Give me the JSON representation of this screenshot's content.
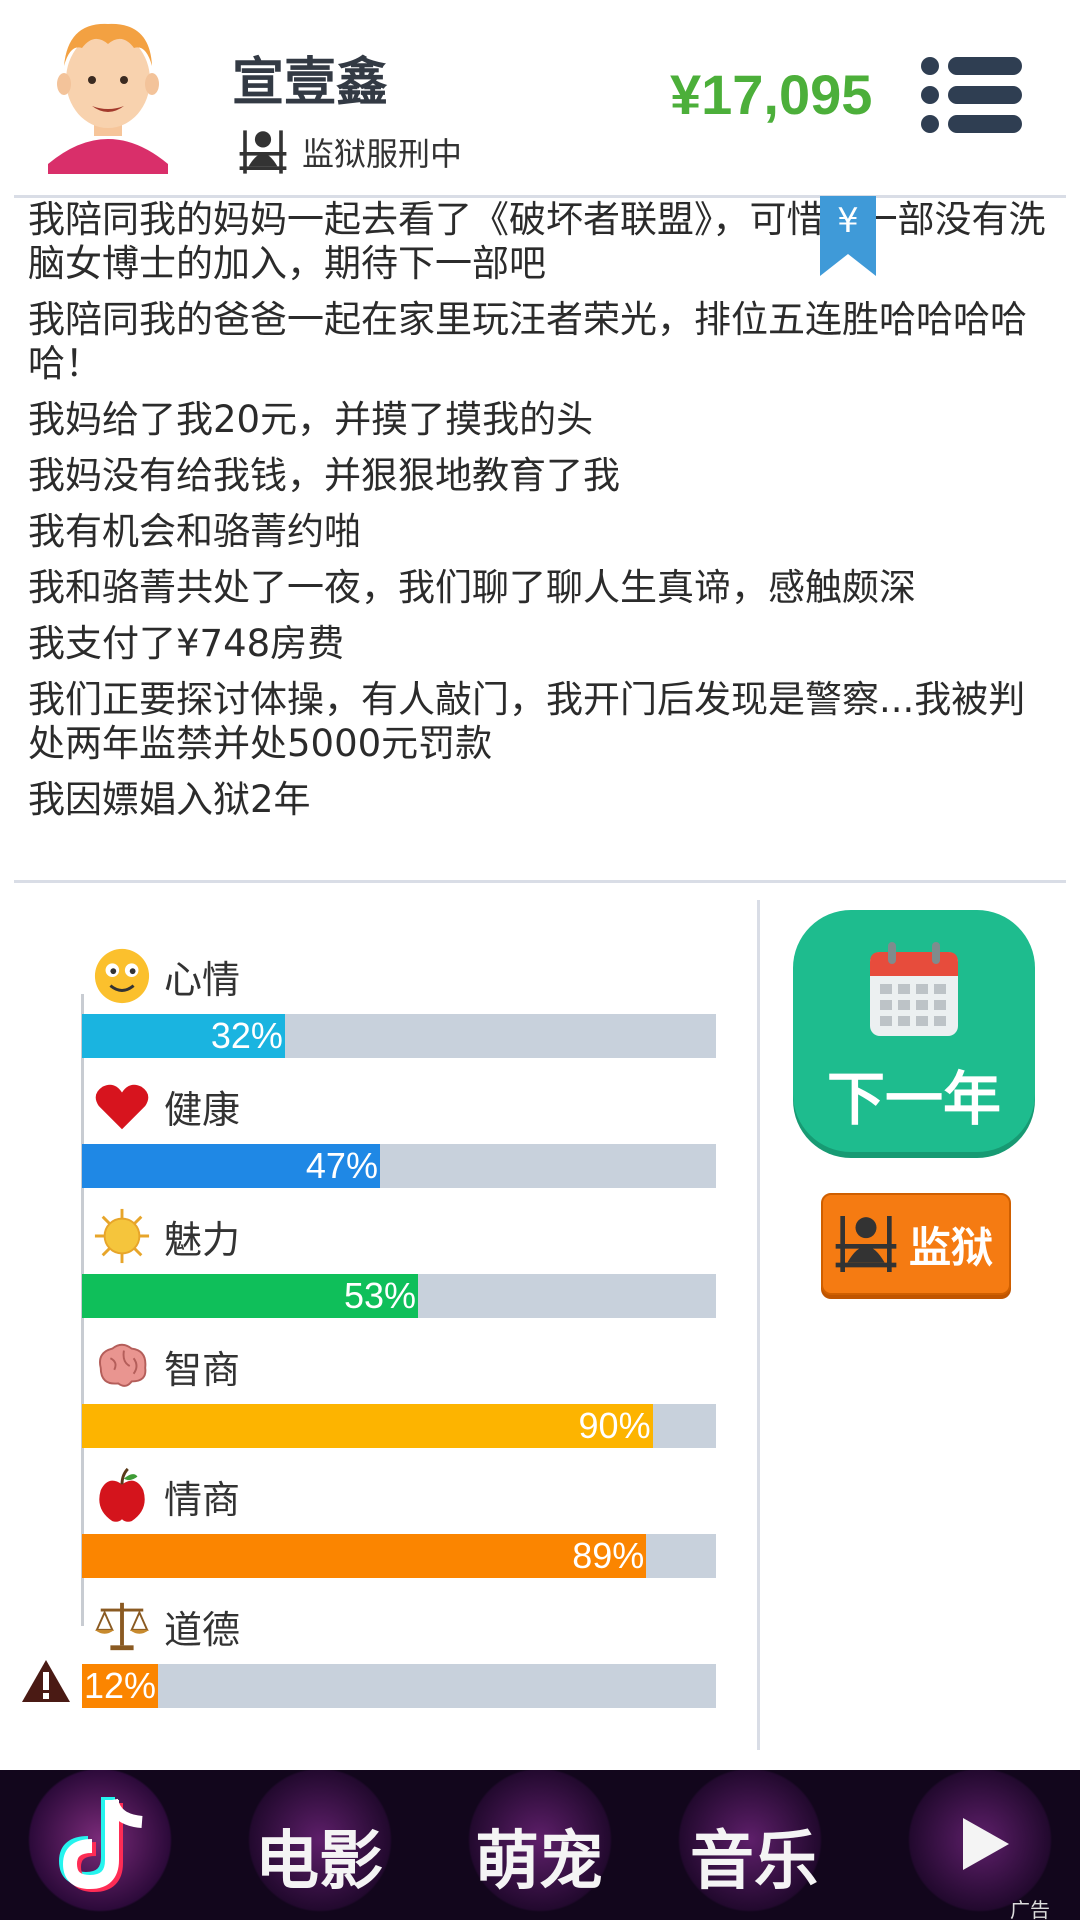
{
  "header": {
    "name": "宣壹鑫",
    "status": "监狱服刑中",
    "money": "¥17,095"
  },
  "log": [
    "我陪同我的妈妈一起去看了《破坏者联盟》，可惜这一部没有洗脑女博士的加入，期待下一部吧",
    "我陪同我的爸爸一起在家里玩汪者荣光，排位五连胜哈哈哈哈哈！",
    "我妈给了我20元，并摸了摸我的头",
    "我妈没有给我钱，并狠狠地教育了我",
    "我有机会和骆菁约啪",
    "我和骆菁共处了一夜，我们聊了聊人生真谛，感触颇深",
    "我支付了¥748房费",
    "我们正要探讨体操，有人敲门，我开门后发现是警察...我被判处两年监禁并处5000元罚款",
    "我因嫖娼入狱2年"
  ],
  "bookmark_symbol": "¥",
  "stats": [
    {
      "label": "心情",
      "pct": "32%",
      "value": 32,
      "color": "#1ab4e0",
      "icon": "smiley-icon"
    },
    {
      "label": "健康",
      "pct": "47%",
      "value": 47,
      "color": "#1f88e5",
      "icon": "heart-icon"
    },
    {
      "label": "魅力",
      "pct": "53%",
      "value": 53,
      "color": "#0fbf5a",
      "icon": "sun-icon"
    },
    {
      "label": "智商",
      "pct": "90%",
      "value": 90,
      "color": "#fdb400",
      "icon": "brain-icon"
    },
    {
      "label": "情商",
      "pct": "89%",
      "value": 89,
      "color": "#fb8500",
      "icon": "apple-icon"
    },
    {
      "label": "道德",
      "pct": "12%",
      "value": 12,
      "color": "#fb8500",
      "icon": "scales-icon"
    }
  ],
  "buttons": {
    "next_year": "下一年",
    "prison": "监狱"
  },
  "ad": {
    "items": [
      "电影",
      "萌宠",
      "音乐"
    ],
    "tag": "广告"
  },
  "colors": {
    "money": "#4caf3a",
    "next_year_bg": "#1ebc8e",
    "prison_bg": "#f57b12",
    "track": "#c8d1dc"
  }
}
